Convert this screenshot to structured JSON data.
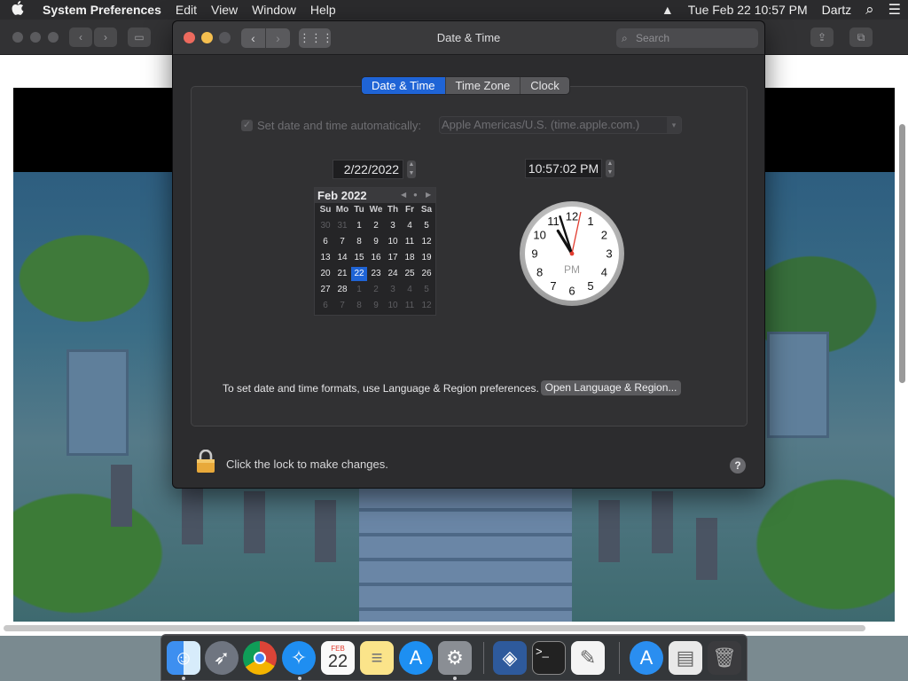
{
  "menubar": {
    "apple_icon": "apple-logo",
    "app_name": "System Preferences",
    "menus": [
      "Edit",
      "View",
      "Window",
      "Help"
    ],
    "datetime": "Tue Feb 22  10:57 PM",
    "user": "Dartz",
    "eject_icon": "▲",
    "search_icon": "⌕",
    "list_icon": "☰"
  },
  "prefs": {
    "title": "Date & Time",
    "search_placeholder": "Search",
    "tabs": [
      {
        "label": "Date & Time",
        "active": true
      },
      {
        "label": "Time Zone",
        "active": false
      },
      {
        "label": "Clock",
        "active": false
      }
    ],
    "auto_set_label": "Set date and time automatically:",
    "auto_set_checked": true,
    "time_server": "Apple Americas/U.S. (time.apple.com.)",
    "date_value": "2/22/2022",
    "time_value": "10:57:02 PM",
    "calendar": {
      "month_label": "Feb 2022",
      "weekdays": [
        "Su",
        "Mo",
        "Tu",
        "We",
        "Th",
        "Fr",
        "Sa"
      ],
      "weeks": [
        [
          "30",
          "31",
          "1",
          "2",
          "3",
          "4",
          "5"
        ],
        [
          "6",
          "7",
          "8",
          "9",
          "10",
          "11",
          "12"
        ],
        [
          "13",
          "14",
          "15",
          "16",
          "17",
          "18",
          "19"
        ],
        [
          "20",
          "21",
          "22",
          "23",
          "24",
          "25",
          "26"
        ],
        [
          "27",
          "28",
          "1",
          "2",
          "3",
          "4",
          "5"
        ],
        [
          "6",
          "7",
          "8",
          "9",
          "10",
          "11",
          "12"
        ]
      ],
      "selected_day": "22"
    },
    "clock": {
      "numbers": [
        "12",
        "1",
        "2",
        "3",
        "4",
        "5",
        "6",
        "7",
        "8",
        "9",
        "10",
        "11"
      ],
      "ampm": "PM",
      "hour": 10,
      "minute": 57,
      "second": 2
    },
    "hint_text": "To set date and time formats, use Language & Region preferences.",
    "open_button": "Open Language & Region...",
    "lock_text": "Click the lock to make changes.",
    "help_label": "?"
  },
  "colors": {
    "accent": "#1f64d6",
    "close": "#ed6a5e",
    "minimize": "#f5bf4f",
    "second_hand": "#e23b2e"
  },
  "dock": {
    "calendar_month": "FEB",
    "calendar_day": "22",
    "apps": [
      "finder-icon",
      "launchpad-icon",
      "chrome-icon",
      "safari-icon",
      "calendar-icon",
      "notes-icon",
      "app-store-icon",
      "system-preferences-icon",
      "virtualbox-icon",
      "terminal-icon",
      "textedit-icon",
      "app-store-download-icon",
      "preview-icon",
      "trash-icon"
    ]
  }
}
